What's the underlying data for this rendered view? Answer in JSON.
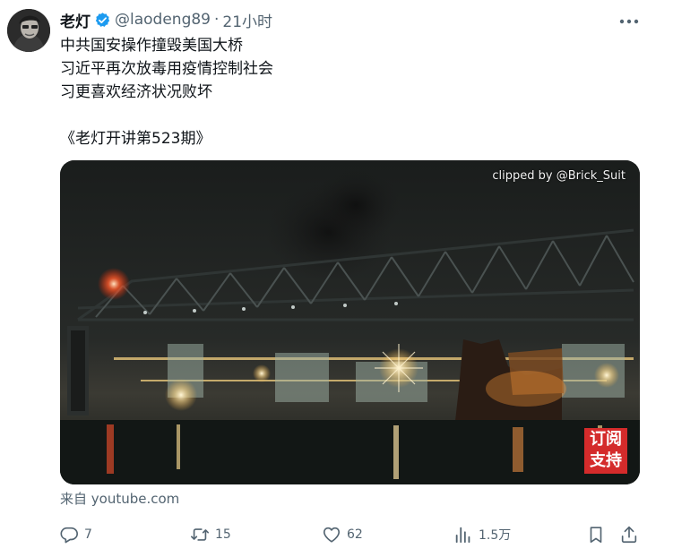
{
  "author": {
    "name": "老灯",
    "handle": "@laodeng89",
    "time": "21小时",
    "verified": true
  },
  "tweet": {
    "lines": [
      "中共国安操作撞毁美国大桥",
      "习近平再次放毒用疫情控制社会",
      "习更喜欢经济状况败坏",
      "",
      "《老灯开讲第523期》"
    ]
  },
  "media": {
    "clip_label": "clipped by @Brick_Suit",
    "badge_line1": "订阅",
    "badge_line2": "支持"
  },
  "source": {
    "prefix": "来自 ",
    "link": "youtube.com"
  },
  "actions": {
    "reply_count": "7",
    "retweet_count": "15",
    "like_count": "62",
    "view_count": "1.5万"
  },
  "colors": {
    "verified": "#1d9bf0",
    "secondary_text": "#536471",
    "badge": "#d42b2b"
  }
}
